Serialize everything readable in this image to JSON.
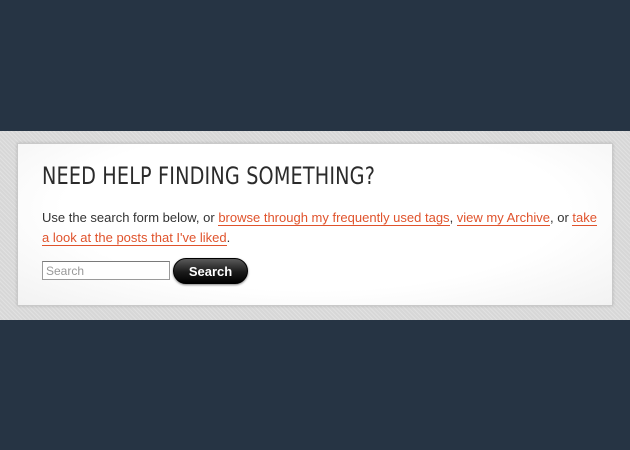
{
  "card": {
    "title": "NEED HELP FINDING SOMETHING?",
    "intro_text": "Use the search form below, or ",
    "link_tags": "browse through my frequently used tags",
    "sep1": ", ",
    "link_archive": "view my Archive",
    "sep2": ", or ",
    "link_liked": "take a look at the posts that I've liked",
    "end": "."
  },
  "search": {
    "placeholder": "Search",
    "button_label": "Search"
  },
  "colors": {
    "background_dark": "#263444",
    "link": "#e0532c",
    "text": "#333333"
  }
}
